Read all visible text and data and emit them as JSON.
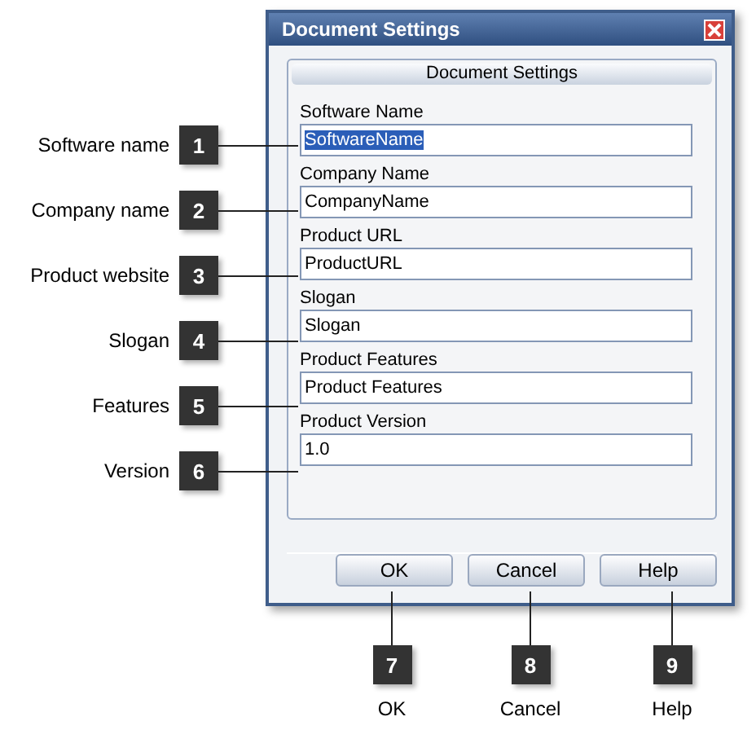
{
  "window": {
    "title": "Document Settings"
  },
  "panel": {
    "title": "Document Settings"
  },
  "fields": [
    {
      "label": "Software Name",
      "value": "SoftwareName",
      "selected": true
    },
    {
      "label": "Company Name",
      "value": "CompanyName",
      "selected": false
    },
    {
      "label": "Product URL",
      "value": "ProductURL",
      "selected": false
    },
    {
      "label": "Slogan",
      "value": "Slogan",
      "selected": false
    },
    {
      "label": "Product Features",
      "value": "Product Features",
      "selected": false
    },
    {
      "label": "Product Version",
      "value": "1.0",
      "selected": false
    }
  ],
  "buttons": [
    "OK",
    "Cancel",
    "Help"
  ],
  "field_callouts": [
    {
      "number": "1",
      "label": "Software name"
    },
    {
      "number": "2",
      "label": "Company name"
    },
    {
      "number": "3",
      "label": "Product website"
    },
    {
      "number": "4",
      "label": "Slogan"
    },
    {
      "number": "5",
      "label": "Features"
    },
    {
      "number": "6",
      "label": "Version"
    }
  ],
  "button_callouts": [
    {
      "number": "7",
      "label": "OK"
    },
    {
      "number": "8",
      "label": "Cancel"
    },
    {
      "number": "9",
      "label": "Help"
    }
  ]
}
